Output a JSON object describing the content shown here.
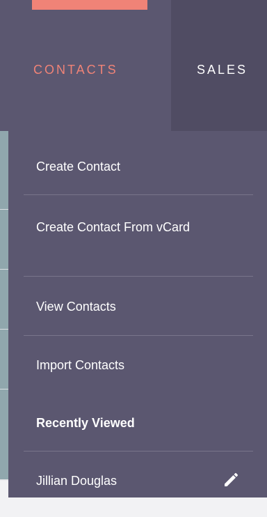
{
  "nav": {
    "tabs": [
      {
        "label": "CONTACTS",
        "active": true
      },
      {
        "label": "SALES",
        "active": false
      }
    ],
    "active_accent_color": "#f08377"
  },
  "dropdown": {
    "items": [
      {
        "label": "Create Contact"
      },
      {
        "label": "Create Contact From vCard"
      },
      {
        "label": "View Contacts"
      },
      {
        "label": "Import Contacts"
      }
    ],
    "recently_viewed": {
      "heading": "Recently Viewed",
      "items": [
        {
          "label": "Jillian Douglas",
          "icon": "pencil-icon"
        }
      ]
    }
  }
}
